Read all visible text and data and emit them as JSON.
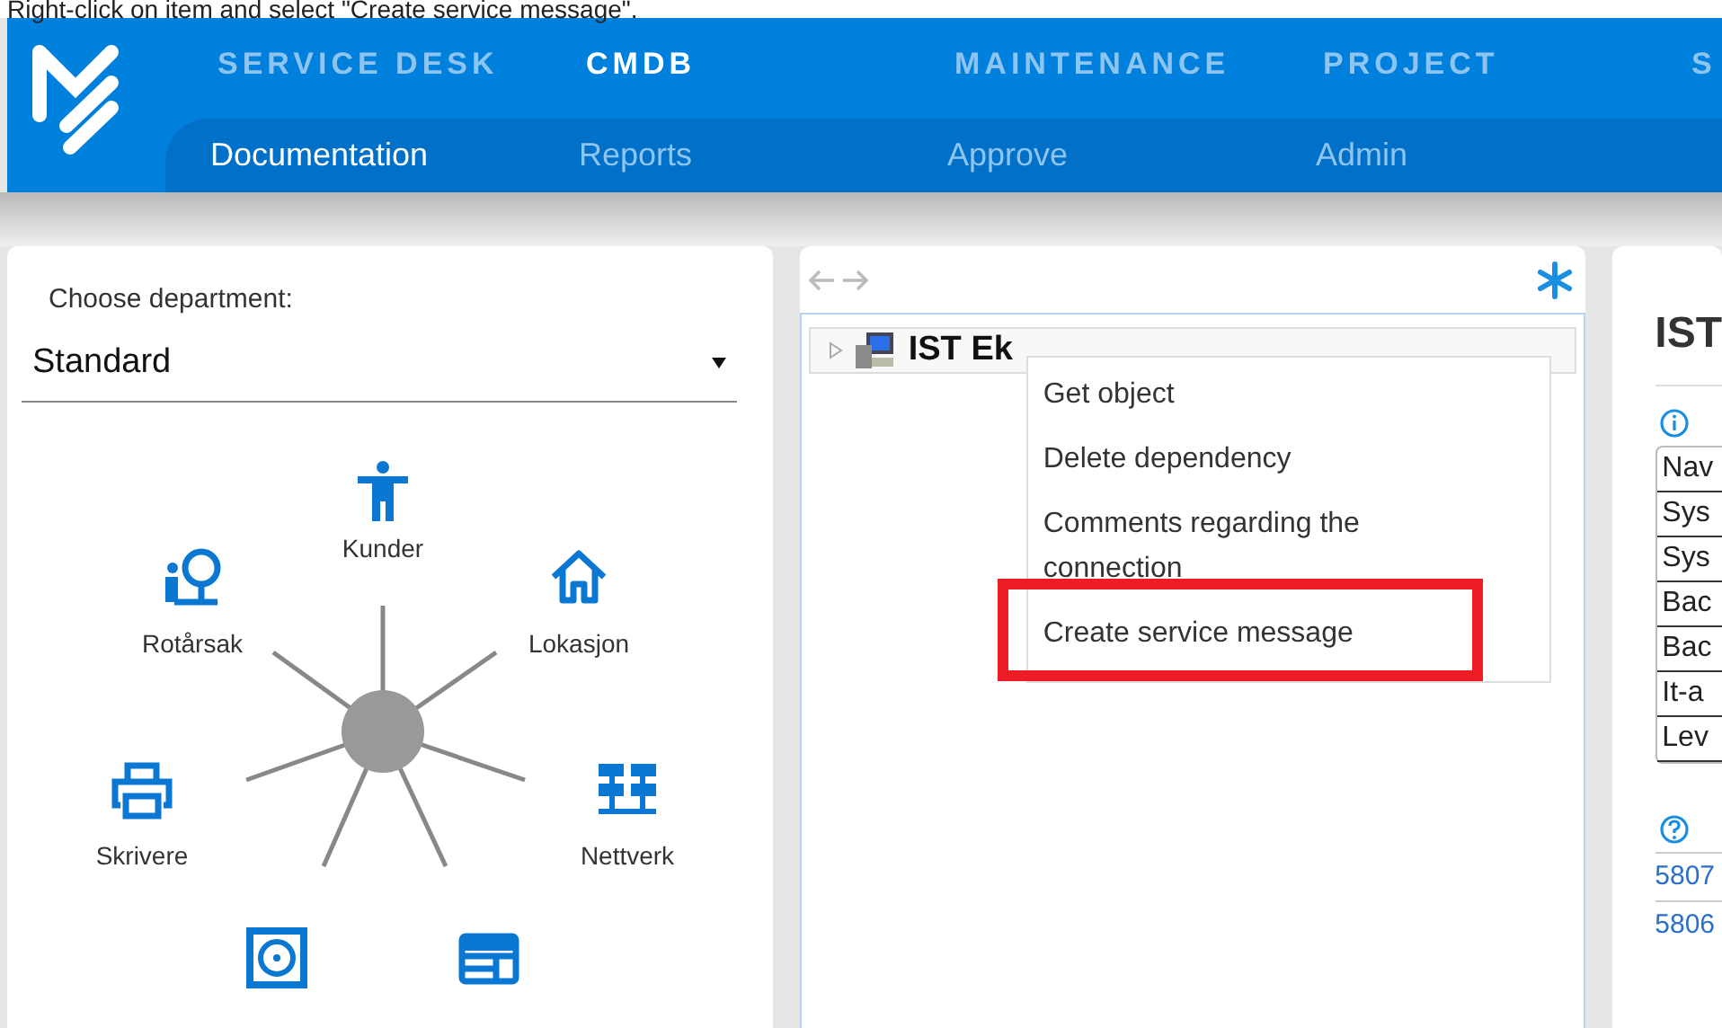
{
  "caption": "Right-click on item and select \"Create service message\".",
  "nav": {
    "main_tabs": [
      {
        "label": "SERVICE DESK",
        "selected": false
      },
      {
        "label": "CMDB",
        "selected": true
      },
      {
        "label": "MAINTENANCE",
        "selected": false
      },
      {
        "label": "PROJECT",
        "selected": false
      },
      {
        "label": "S",
        "selected": false
      }
    ],
    "sub_tabs": [
      {
        "label": "Documentation",
        "selected": true
      },
      {
        "label": "Reports",
        "selected": false
      },
      {
        "label": "Approve",
        "selected": false
      },
      {
        "label": "Admin",
        "selected": false
      }
    ]
  },
  "department": {
    "label": "Choose department:",
    "value": "Standard"
  },
  "diagram": {
    "nodes": [
      {
        "kind": "person",
        "label": "Kunder"
      },
      {
        "kind": "house",
        "label": "Lokasjon"
      },
      {
        "kind": "network",
        "label": "Nettverk"
      },
      {
        "kind": "window"
      },
      {
        "kind": "disk"
      },
      {
        "kind": "printer",
        "label": "Skrivere"
      },
      {
        "kind": "root-cause",
        "label": "Rotårsak"
      }
    ]
  },
  "tree": {
    "items": [
      {
        "label": "IST Ek",
        "expanded": false
      }
    ]
  },
  "context_menu": [
    {
      "label": "Get object",
      "highlighted": false
    },
    {
      "label": "Delete dependency",
      "highlighted": false
    },
    {
      "label": "Comments regarding the connection",
      "highlighted": false
    },
    {
      "label": "Create service message",
      "highlighted": true
    }
  ],
  "details": {
    "title": "IST",
    "fields": [
      "Nav",
      "Sys",
      "Sys",
      "Bac",
      "Bac",
      "It-a",
      "Lev"
    ],
    "links": [
      "5807",
      "5806"
    ]
  }
}
